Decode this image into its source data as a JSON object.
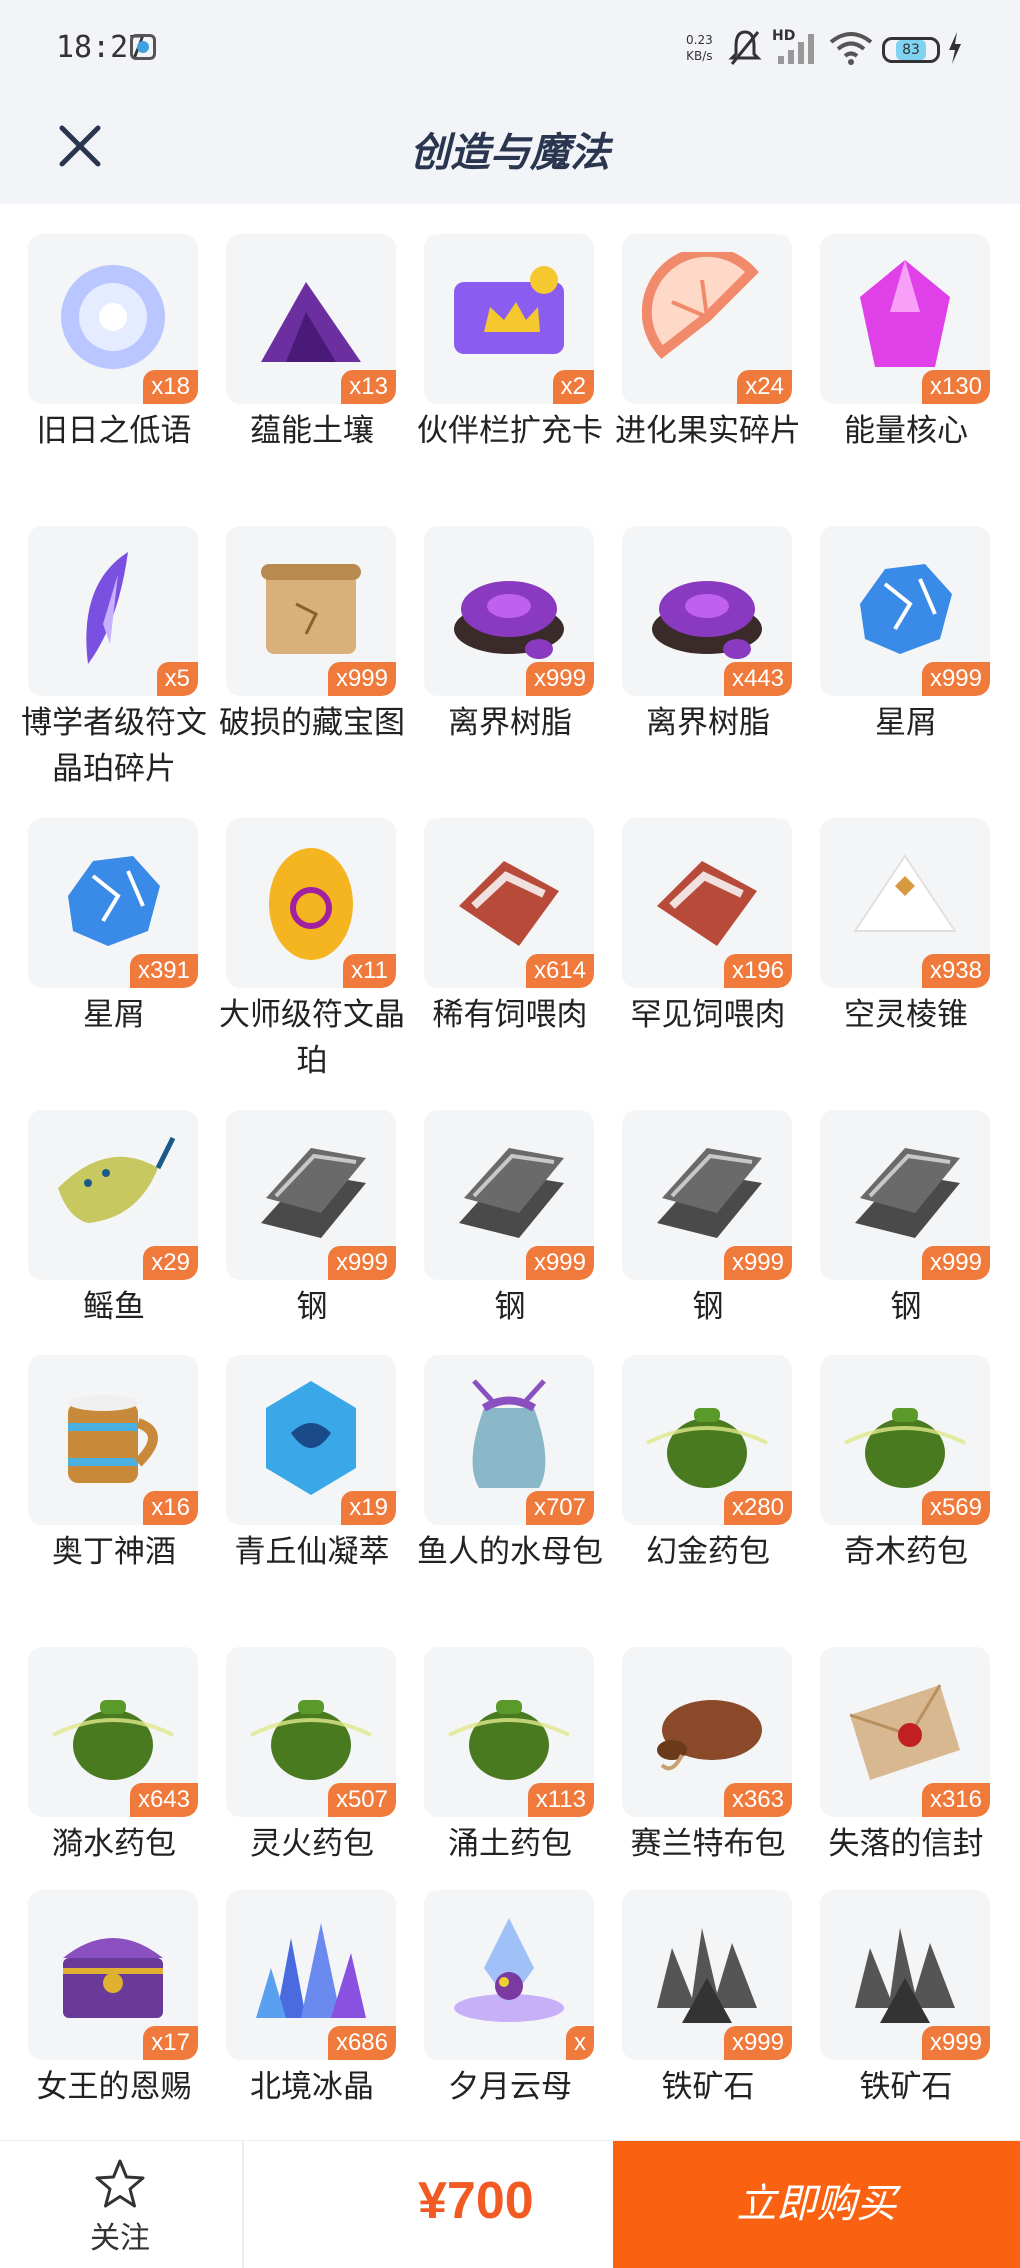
{
  "status_bar": {
    "time": "18:27",
    "net_speed_value": "0.23",
    "net_speed_unit": "KB/s",
    "signal_tag": "HD",
    "battery": "83"
  },
  "header": {
    "title": "创造与魔法"
  },
  "items": [
    {
      "name": "旧日之低语",
      "qty": "x18",
      "icon": "orb-icon",
      "color": "#b9c6ff"
    },
    {
      "name": "蕴能土壤",
      "qty": "x13",
      "icon": "soil-icon",
      "color": "#6b2fa0"
    },
    {
      "name": "伙伴栏扩充卡",
      "qty": "x2",
      "icon": "card-icon",
      "color": "#8a5cf0"
    },
    {
      "name": "进化果实碎片",
      "qty": "x24",
      "icon": "fruit-icon",
      "color": "#f08a6a"
    },
    {
      "name": "能量核心",
      "qty": "x130",
      "icon": "crystal-icon",
      "color": "#e040e8"
    },
    {
      "name": "博学者级符文晶珀碎片",
      "qty": "x5",
      "icon": "shard-icon",
      "color": "#7a50e0"
    },
    {
      "name": "破损的藏宝图",
      "qty": "x999",
      "icon": "scroll-icon",
      "color": "#d9b07a"
    },
    {
      "name": "离界树脂",
      "qty": "x999",
      "icon": "resin-icon",
      "color": "#8a3ac0"
    },
    {
      "name": "离界树脂",
      "qty": "x443",
      "icon": "resin-icon",
      "color": "#8a3ac0"
    },
    {
      "name": "星屑",
      "qty": "x999",
      "icon": "stardust-icon",
      "color": "#3a8ae8"
    },
    {
      "name": "星屑",
      "qty": "x391",
      "icon": "stardust-icon",
      "color": "#3a8ae8"
    },
    {
      "name": "大师级符文晶珀",
      "qty": "x11",
      "icon": "amber-icon",
      "color": "#f5b520"
    },
    {
      "name": "稀有饲喂肉",
      "qty": "x614",
      "icon": "meat-icon",
      "color": "#b84a3a"
    },
    {
      "name": "罕见饲喂肉",
      "qty": "x196",
      "icon": "meat-icon",
      "color": "#b84a3a"
    },
    {
      "name": "空灵棱锥",
      "qty": "x938",
      "icon": "pyramid-icon",
      "color": "#f0f0f0"
    },
    {
      "name": "鳐鱼",
      "qty": "x29",
      "icon": "ray-fish-icon",
      "color": "#c8c860"
    },
    {
      "name": "钢",
      "qty": "x999",
      "icon": "steel-icon",
      "color": "#6a6a6a"
    },
    {
      "name": "钢",
      "qty": "x999",
      "icon": "steel-icon",
      "color": "#6a6a6a"
    },
    {
      "name": "钢",
      "qty": "x999",
      "icon": "steel-icon",
      "color": "#6a6a6a"
    },
    {
      "name": "钢",
      "qty": "x999",
      "icon": "steel-icon",
      "color": "#6a6a6a"
    },
    {
      "name": "奥丁神酒",
      "qty": "x16",
      "icon": "mug-icon",
      "color": "#c88a3a"
    },
    {
      "name": "青丘仙凝萃",
      "qty": "x19",
      "icon": "gem-icon",
      "color": "#3aa8e8"
    },
    {
      "name": "鱼人的水母包",
      "qty": "x707",
      "icon": "sack-icon",
      "color": "#8ab8c8"
    },
    {
      "name": "幻金药包",
      "qty": "x280",
      "icon": "herb-pouch-icon",
      "color": "#4a7a20"
    },
    {
      "name": "奇木药包",
      "qty": "x569",
      "icon": "herb-pouch-icon",
      "color": "#4a7a20"
    },
    {
      "name": "漪水药包",
      "qty": "x643",
      "icon": "herb-pouch-icon",
      "color": "#4a7a20"
    },
    {
      "name": "灵火药包",
      "qty": "x507",
      "icon": "herb-pouch-icon",
      "color": "#4a7a20"
    },
    {
      "name": "涌土药包",
      "qty": "x113",
      "icon": "herb-pouch-icon",
      "color": "#4a7a20"
    },
    {
      "name": "赛兰特布包",
      "qty": "x363",
      "icon": "leather-bag-icon",
      "color": "#8a4a2a"
    },
    {
      "name": "失落的信封",
      "qty": "x316",
      "icon": "envelope-icon",
      "color": "#d8b890"
    },
    {
      "name": "女王的恩赐",
      "qty": "x17",
      "icon": "chest-icon",
      "color": "#6a3a9a"
    },
    {
      "name": "北境冰晶",
      "qty": "x686",
      "icon": "ice-crystal-icon",
      "color": "#4a6ae0"
    },
    {
      "name": "夕月云母",
      "qty": "x",
      "icon": "mica-icon",
      "color": "#a070e0"
    },
    {
      "name": "铁矿石",
      "qty": "x999",
      "icon": "iron-ore-icon",
      "color": "#555555"
    },
    {
      "name": "铁矿石",
      "qty": "x999",
      "icon": "iron-ore-icon",
      "color": "#555555"
    }
  ],
  "bottom_bar": {
    "follow_label": "关注",
    "price": "¥700",
    "buy_label": "立即购买"
  },
  "colors": {
    "accent": "#fa6211",
    "badge": "#f07a3c",
    "price": "#f15a22"
  }
}
